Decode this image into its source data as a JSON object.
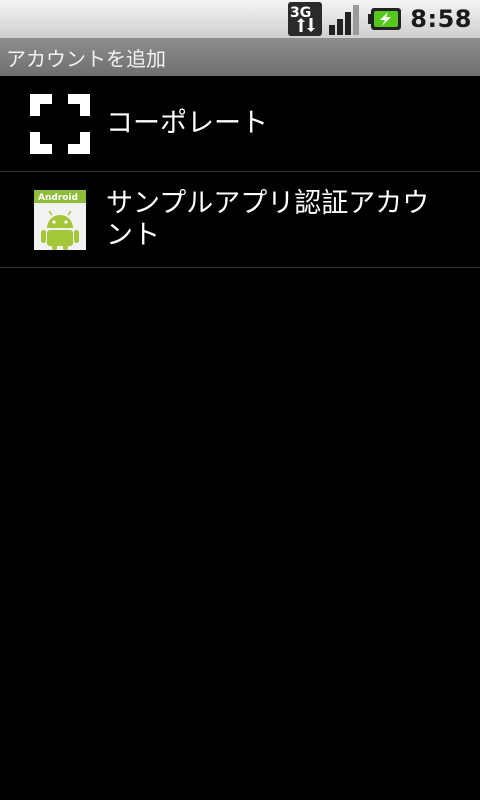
{
  "status_bar": {
    "network_label": "3G",
    "time": "8:58",
    "icons": [
      "3g-data-icon",
      "signal-strength-icon",
      "battery-charging-icon"
    ]
  },
  "title_bar": {
    "title": "アカウントを追加"
  },
  "account_types": [
    {
      "label": "コーポレート",
      "icon": "corporate-bracket-icon"
    },
    {
      "label": "サンプルアプリ認証アカウント",
      "icon": "android-app-icon",
      "icon_caption": "Android"
    }
  ],
  "colors": {
    "background": "#000000",
    "title_bar": "#7f7f7f",
    "status_bar": "#e0e0e0",
    "android_green": "#a4c639"
  }
}
